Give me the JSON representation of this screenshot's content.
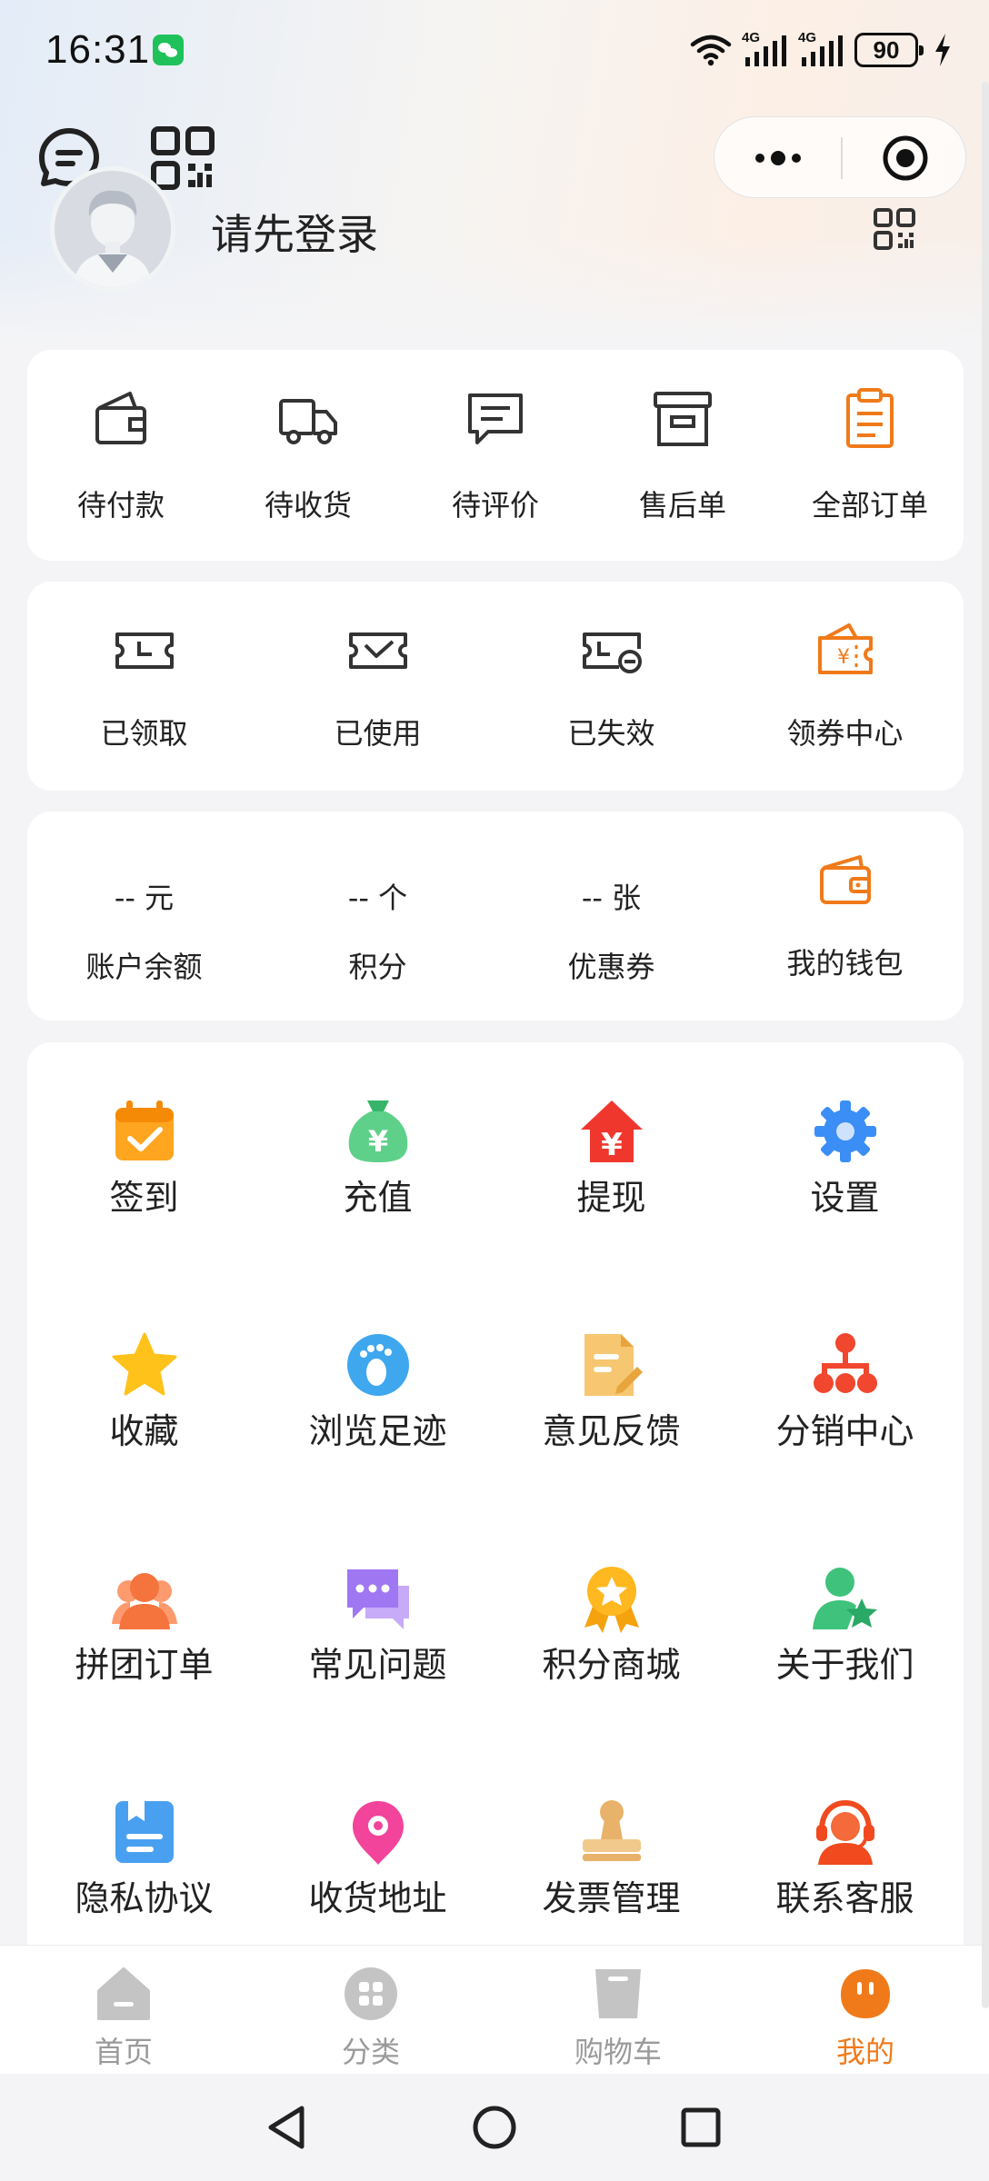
{
  "status_bar": {
    "time": "16:31",
    "battery": "90",
    "network_left": "4G",
    "network_right": "4G",
    "icons": [
      "wechat-icon",
      "wifi-icon",
      "signal-icon",
      "signal-icon",
      "battery-icon",
      "charging-icon"
    ]
  },
  "header": {
    "chat_icon": "chat-icon",
    "qr_icon": "qr-code-icon",
    "capsule": {
      "more_icon": "more-dots-icon",
      "close_icon": "target-close-icon"
    }
  },
  "profile": {
    "login_prompt": "请先登录",
    "avatar_icon": "default-avatar",
    "qr_icon": "qr-code-icon"
  },
  "orders": [
    {
      "label": "待付款",
      "icon": "wallet-icon"
    },
    {
      "label": "待收货",
      "icon": "truck-icon"
    },
    {
      "label": "待评价",
      "icon": "comment-icon"
    },
    {
      "label": "售后单",
      "icon": "archive-box-icon"
    },
    {
      "label": "全部订单",
      "icon": "clipboard-icon"
    }
  ],
  "coupons": [
    {
      "label": "已领取",
      "icon": "ticket-clock-icon"
    },
    {
      "label": "已使用",
      "icon": "ticket-check-icon"
    },
    {
      "label": "已失效",
      "icon": "ticket-expired-icon"
    },
    {
      "label": "领券中心",
      "icon": "coupon-center-icon"
    }
  ],
  "wallet": [
    {
      "value": "-- 元",
      "label": "账户余额"
    },
    {
      "value": "-- 个",
      "label": "积分"
    },
    {
      "value": "-- 张",
      "label": "优惠券"
    },
    {
      "label": "我的钱包",
      "icon": "wallet-icon"
    }
  ],
  "menu": [
    {
      "label": "签到",
      "icon": "calendar-check-icon"
    },
    {
      "label": "充值",
      "icon": "money-bag-icon"
    },
    {
      "label": "提现",
      "icon": "withdraw-house-icon"
    },
    {
      "label": "设置",
      "icon": "gear-icon"
    },
    {
      "label": "收藏",
      "icon": "star-icon"
    },
    {
      "label": "浏览足迹",
      "icon": "footprint-icon"
    },
    {
      "label": "意见反馈",
      "icon": "feedback-doc-icon"
    },
    {
      "label": "分销中心",
      "icon": "org-chart-icon"
    },
    {
      "label": "拼团订单",
      "icon": "group-users-icon"
    },
    {
      "label": "常见问题",
      "icon": "chat-bubbles-icon"
    },
    {
      "label": "积分商城",
      "icon": "medal-icon"
    },
    {
      "label": "关于我们",
      "icon": "user-star-icon"
    },
    {
      "label": "隐私协议",
      "icon": "document-icon"
    },
    {
      "label": "收货地址",
      "icon": "location-pin-icon"
    },
    {
      "label": "发票管理",
      "icon": "stamp-icon"
    },
    {
      "label": "联系客服",
      "icon": "headset-agent-icon"
    }
  ],
  "tabs": [
    {
      "label": "首页",
      "icon": "home-icon",
      "active": false
    },
    {
      "label": "分类",
      "icon": "category-icon",
      "active": false
    },
    {
      "label": "购物车",
      "icon": "cart-icon",
      "active": false
    },
    {
      "label": "我的",
      "icon": "profile-icon",
      "active": true
    }
  ],
  "colors": {
    "accent": "#f07a1a",
    "text": "#222222",
    "tab_inactive": "#9a9a9a",
    "background": "#f4f4f6",
    "card": "#ffffff"
  },
  "system_nav": [
    "back-icon",
    "home-circle-icon",
    "recents-icon"
  ]
}
